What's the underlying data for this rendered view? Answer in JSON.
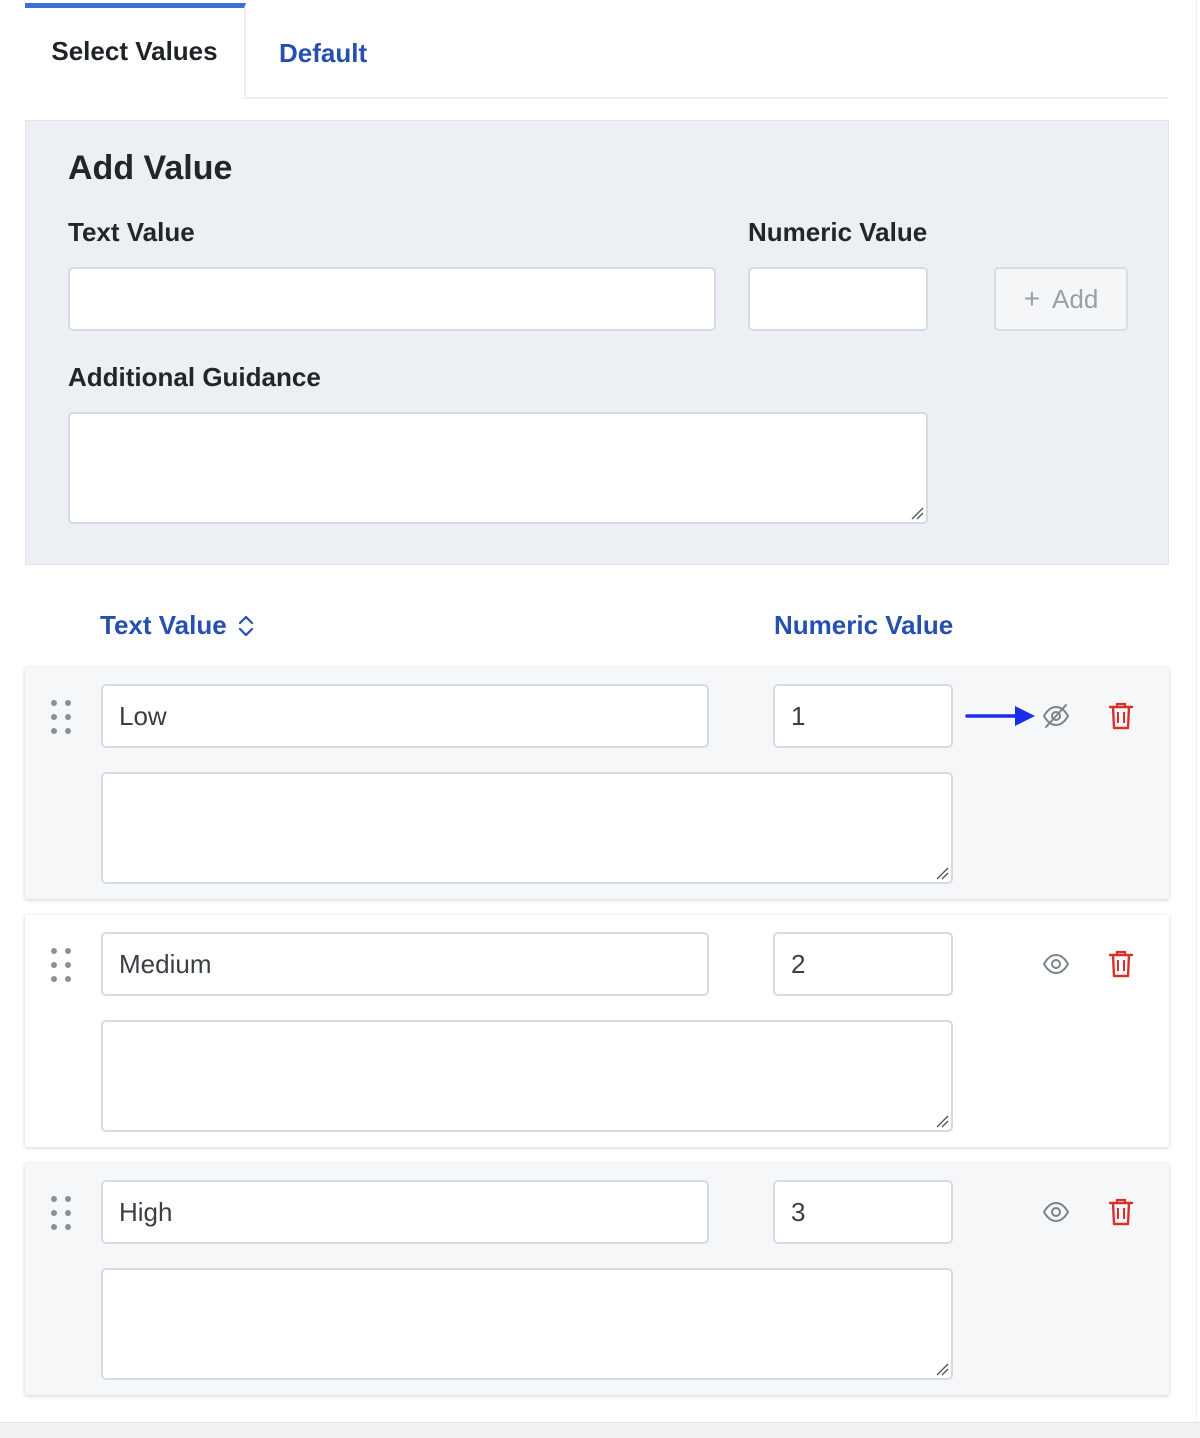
{
  "tabs": [
    {
      "label": "Select Values",
      "active": true
    },
    {
      "label": "Default",
      "active": false
    }
  ],
  "add_panel": {
    "title": "Add Value",
    "text_value_label": "Text Value",
    "numeric_value_label": "Numeric Value",
    "guidance_label": "Additional Guidance",
    "text_value": "",
    "numeric_value": "",
    "guidance_value": "",
    "add_button": {
      "icon": "plus-icon",
      "label": "Add"
    }
  },
  "table": {
    "columns": [
      {
        "label": "Text Value",
        "sortable": true,
        "sort_icon": "sort-icon"
      },
      {
        "label": "Numeric Value",
        "sortable": false
      }
    ],
    "rows": [
      {
        "text": "Low",
        "numeric": "1",
        "guidance": "",
        "visibility_icon": "eye-off-icon",
        "delete_icon": "trash-icon",
        "highlighted": true
      },
      {
        "text": "Medium",
        "numeric": "2",
        "guidance": "",
        "visibility_icon": "eye-icon",
        "delete_icon": "trash-icon",
        "highlighted": false
      },
      {
        "text": "High",
        "numeric": "3",
        "guidance": "",
        "visibility_icon": "eye-icon",
        "delete_icon": "trash-icon",
        "highlighted": false
      }
    ]
  },
  "colors": {
    "accent": "#3f6fd6",
    "link": "#2550b0",
    "delete": "#d9302c",
    "annotation_arrow": "#1a2ee8"
  }
}
